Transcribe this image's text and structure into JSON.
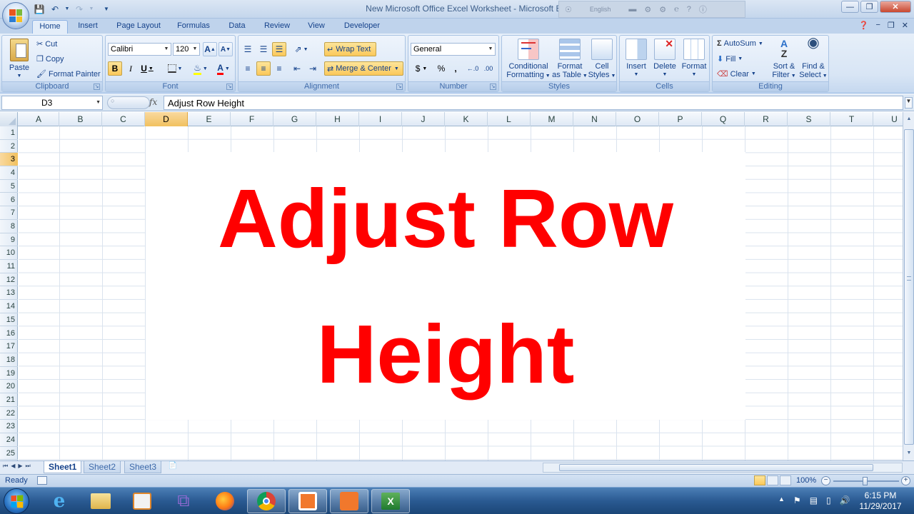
{
  "window": {
    "title": "New Microsoft Office Excel Worksheet - Microsoft Excel",
    "ime_language": "English"
  },
  "tabs": [
    "Home",
    "Insert",
    "Page Layout",
    "Formulas",
    "Data",
    "Review",
    "View",
    "Developer"
  ],
  "ribbon": {
    "clipboard": {
      "label": "Clipboard",
      "paste": "Paste",
      "cut": "Cut",
      "copy": "Copy",
      "format_painter": "Format Painter"
    },
    "font": {
      "label": "Font",
      "font_name": "Calibri",
      "font_size": "120"
    },
    "alignment": {
      "label": "Alignment",
      "wrap_text": "Wrap Text",
      "merge_center": "Merge & Center"
    },
    "number": {
      "label": "Number",
      "format": "General",
      "currency": "$",
      "percent": "%",
      "comma": ","
    },
    "styles": {
      "label": "Styles",
      "conditional_1": "Conditional",
      "conditional_2": "Formatting",
      "format_table_1": "Format",
      "format_table_2": "as Table",
      "cell_styles_1": "Cell",
      "cell_styles_2": "Styles"
    },
    "cells": {
      "label": "Cells",
      "insert": "Insert",
      "delete": "Delete",
      "format": "Format"
    },
    "editing": {
      "label": "Editing",
      "autosum": "AutoSum",
      "fill": "Fill",
      "clear": "Clear",
      "sort_1": "Sort &",
      "sort_2": "Filter",
      "find_1": "Find &",
      "find_2": "Select"
    }
  },
  "formula_bar": {
    "name_box": "D3",
    "fx": "fx",
    "content": "Adjust Row Height"
  },
  "columns": [
    "A",
    "B",
    "C",
    "D",
    "E",
    "F",
    "G",
    "H",
    "I",
    "J",
    "K",
    "L",
    "M",
    "N",
    "O",
    "P",
    "Q",
    "R",
    "S",
    "T",
    "U"
  ],
  "rows": [
    "1",
    "2",
    "3",
    "4",
    "5",
    "6",
    "7",
    "8",
    "9",
    "10",
    "11",
    "12",
    "13",
    "14",
    "15",
    "16",
    "17",
    "18",
    "19",
    "20",
    "21",
    "22",
    "23",
    "24",
    "25"
  ],
  "selected_cell": {
    "column": "D",
    "row": "3"
  },
  "cell_text": "Adjust Row Height",
  "sheets": [
    "Sheet1",
    "Sheet2",
    "Sheet3"
  ],
  "active_sheet": "Sheet1",
  "status": {
    "ready": "Ready",
    "zoom": "100%"
  },
  "taskbar": {
    "time": "6:15 PM",
    "date": "11/29/2017"
  },
  "colors": {
    "cell_text": "#ff0000",
    "ribbon_bg": "#dce8f7",
    "selection_header": "#f1c15f"
  }
}
